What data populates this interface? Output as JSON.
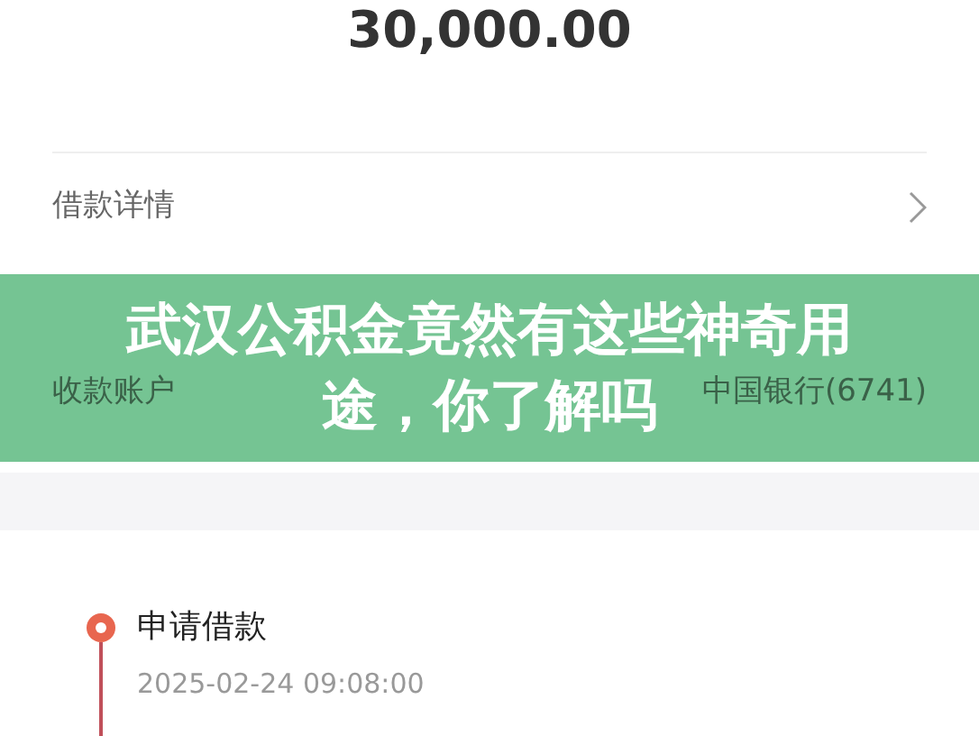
{
  "amount": "30,000.00",
  "rows": [
    {
      "label": "借款详情",
      "kind": "link"
    },
    {
      "label": "收款账户",
      "value": "中国银行(6741)",
      "kind": "value"
    }
  ],
  "timeline": [
    {
      "title": "申请借款",
      "time": "2025-02-24 09:08:00"
    }
  ],
  "banner": {
    "title_lines": [
      "武汉公积金竟然有这些神奇用",
      "途，你了解吗"
    ]
  }
}
